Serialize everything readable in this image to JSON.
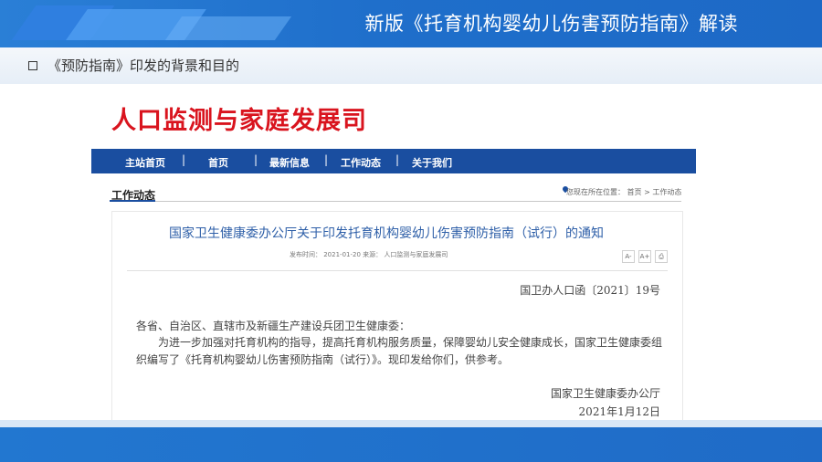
{
  "slide": {
    "title": "新版《托育机构婴幼儿伤害预防指南》解读",
    "subtitle": "《预防指南》印发的背景和目的"
  },
  "website": {
    "site_title": "人口监测与家庭发展司",
    "nav": [
      "主站首页",
      "首页",
      "最新信息",
      "工作动态",
      "关于我们"
    ],
    "nav_separator": "|",
    "section_title": "工作动态",
    "breadcrumb": "您现在所在位置： 首页 > 工作动态",
    "article": {
      "title": "国家卫生健康委办公厅关于印发托育机构婴幼儿伤害预防指南（试行）的通知",
      "meta": "发布时间： 2021-01-20   来源： 人口监测与家庭发展司",
      "font_buttons": [
        "A-",
        "A+",
        "⎙"
      ],
      "doc_number": "国卫办人口函〔2021〕19号",
      "addressee": "各省、自治区、直辖市及新疆生产建设兵团卫生健康委：",
      "body": "为进一步加强对托育机构的指导，提高托育机构服务质量，保障婴幼儿安全健康成长，国家卫生健康委组织编写了《托育机构婴幼儿伤害预防指南（试行）》。现印发给你们，供参考。",
      "signature": "国家卫生健康委办公厅",
      "date": "2021年1月12日"
    }
  },
  "colors": {
    "banner_blue": "#1f6fcb",
    "nav_blue": "#1a4ea0",
    "site_title_red": "#d9141e",
    "article_title_blue": "#2e5fa8"
  },
  "icons": {
    "slide_bullet": "square-outline-icon",
    "location": "location-pin-icon",
    "print": "print-icon"
  }
}
